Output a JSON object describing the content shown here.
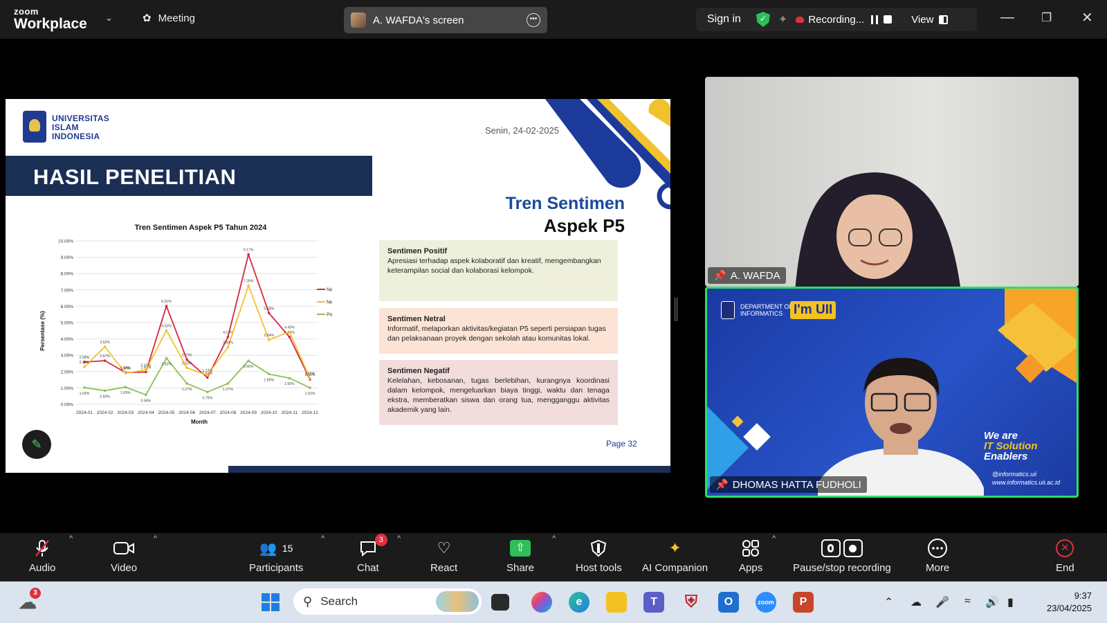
{
  "titlebar": {
    "brand_top": "zoom",
    "brand_bottom": "Workplace",
    "meeting_label": "Meeting",
    "screen_label": "A. WAFDA's screen",
    "signin": "Sign in",
    "recording": "Recording...",
    "view": "View"
  },
  "slide": {
    "university": [
      "UNIVERSITAS",
      "ISLAM",
      "INDONESIA"
    ],
    "date": "Senin, 24-02-2025",
    "heading": "HASIL PENELITIAN",
    "title_line1": "Tren Sentimen",
    "title_line2": "Aspek P5",
    "boxes": [
      {
        "title": "Sentimen Positif",
        "text": "Apresiasi terhadap aspek kolaboratif dan kreatif, mengembangkan keterampilan social dan kolaborasi kelompok."
      },
      {
        "title": "Sentimen Netral",
        "text": "Informatif, melaporkan aktivitas/kegiatan P5 seperti persiapan tugas dan pelaksanaan proyek dengan sekolah atau komunitas lokal."
      },
      {
        "title": "Sentimen Negatif",
        "text": "Kelelahan, kebosanan, tugas berlebihan, kurangnya koordinasi dalam kelompok, mengeluarkan biaya tinggi, waktu dan tenaga ekstra, memberatkan siswa dan orang tua, mengganggu aktivitas akademik yang lain."
      }
    ],
    "page": "Page 32"
  },
  "chart_data": {
    "type": "line",
    "title": "Tren Sentimen Aspek P5 Tahun 2024",
    "xlabel": "Month",
    "ylabel": "Persentase (%)",
    "ylim": [
      0,
      10
    ],
    "yticks": [
      "0.00%",
      "1.00%",
      "2.00%",
      "3.00%",
      "4.00%",
      "5.00%",
      "6.00%",
      "7.00%",
      "8.00%",
      "9.00%",
      "10.00%"
    ],
    "categories": [
      "2024-01",
      "2024-02",
      "2024-03",
      "2024-04",
      "2024-05",
      "2024-06",
      "2024-07",
      "2024-08",
      "2024-09",
      "2024-10",
      "2024-11",
      "2024-12"
    ],
    "legend_position": "right",
    "series": [
      {
        "name": "Negative",
        "color": "#d7263d",
        "values": [
          2.58,
          2.67,
          1.94,
          1.97,
          6.01,
          2.73,
          1.63,
          4.12,
          9.17,
          5.58,
          4.12,
          1.52
        ]
      },
      {
        "name": "Neutral",
        "color": "#f2c12e",
        "values": [
          2.29,
          3.52,
          1.9,
          2.1,
          4.52,
          2.23,
          1.77,
          3.49,
          7.26,
          3.94,
          4.43,
          1.58
        ]
      },
      {
        "name": "Positive",
        "color": "#8cc152",
        "values": [
          1.02,
          0.83,
          1.05,
          0.58,
          2.82,
          1.27,
          0.75,
          1.27,
          2.66,
          1.85,
          1.6,
          1.01
        ]
      }
    ]
  },
  "videos": {
    "p1_name": "A. WAFDA",
    "p2_name": "DHOMAS HATTA FUDHOLI",
    "dept": [
      "DEPARTMENT OF",
      "INFORMATICS"
    ],
    "imuii": "I'm UII",
    "weare": [
      "We are",
      "IT Solution",
      "Enablers"
    ],
    "links": [
      "@informatics.uii",
      "www.informatics.uii.ac.id"
    ]
  },
  "toolbar": {
    "audio": "Audio",
    "video": "Video",
    "participants": "Participants",
    "participants_count": "15",
    "chat": "Chat",
    "chat_badge": "3",
    "react": "React",
    "share": "Share",
    "host_tools": "Host tools",
    "ai_companion": "AI Companion",
    "apps": "Apps",
    "pause_stop": "Pause/stop recording",
    "more": "More",
    "end": "End"
  },
  "taskbar": {
    "weather_badge": "3",
    "search": "Search",
    "time": "9:37",
    "date": "23/04/2025"
  }
}
